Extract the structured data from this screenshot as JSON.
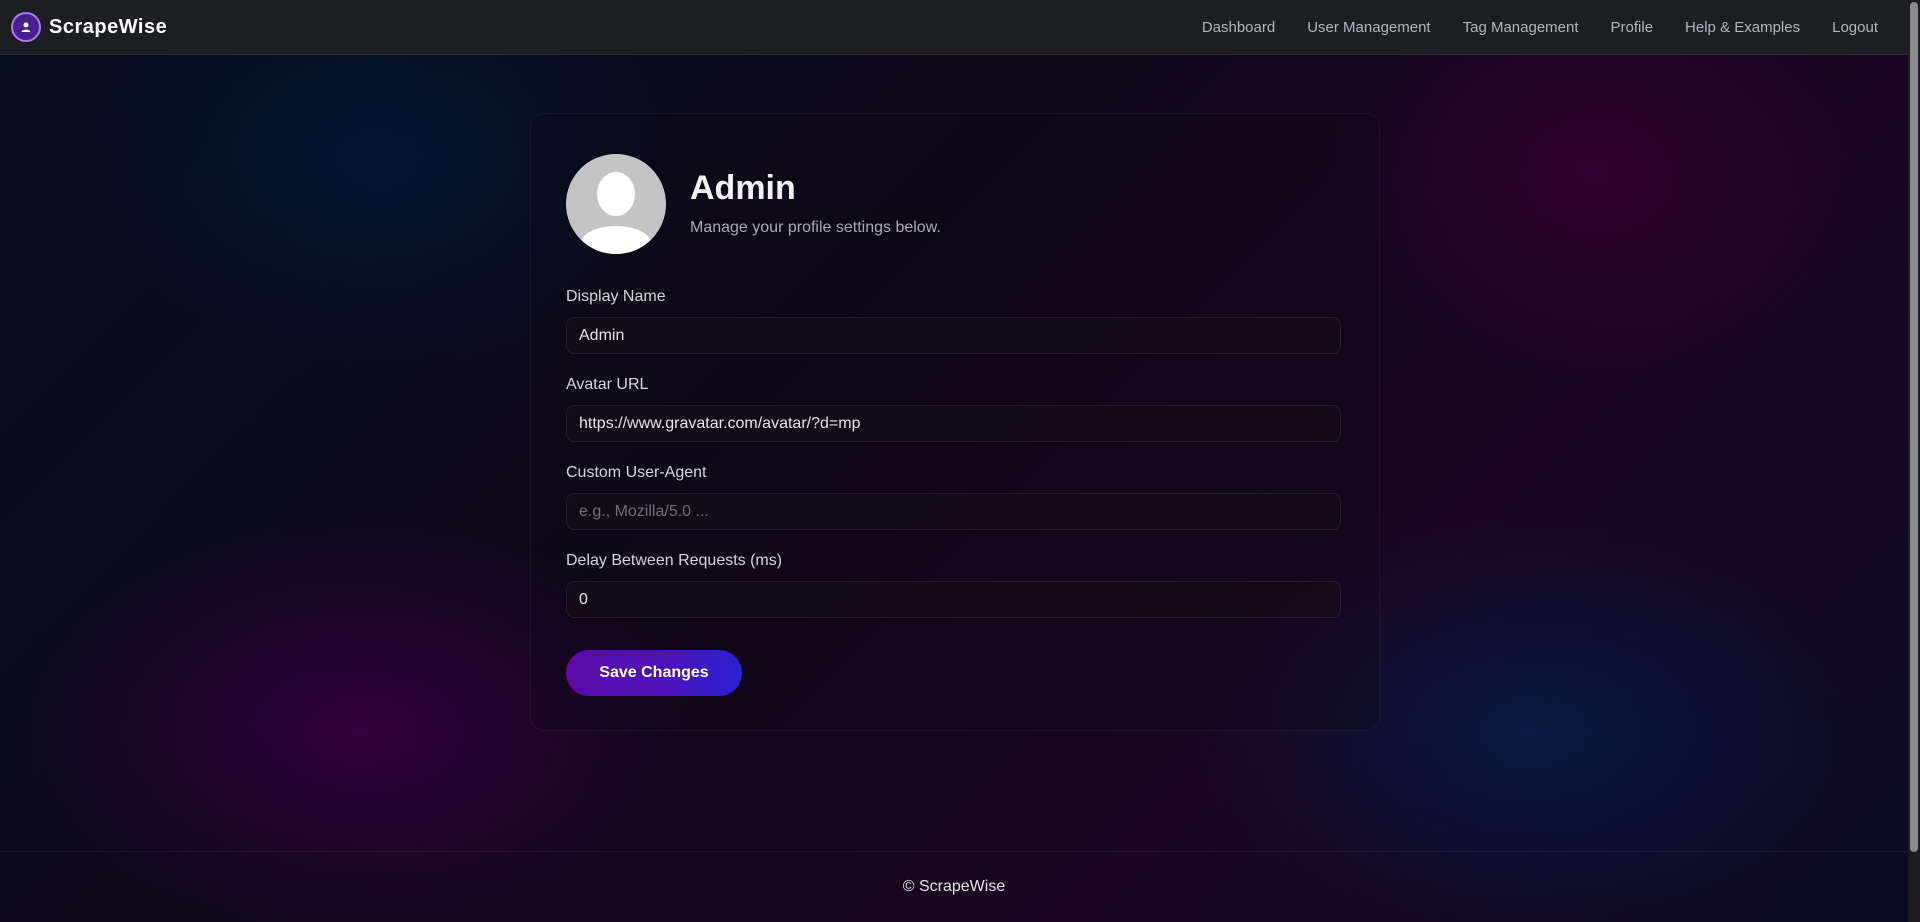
{
  "brand": {
    "name": "ScrapeWise",
    "logo_icon": "user-icon",
    "accent": "#a77ef0"
  },
  "nav": {
    "items": [
      {
        "label": "Dashboard"
      },
      {
        "label": "User Management"
      },
      {
        "label": "Tag Management"
      },
      {
        "label": "Profile"
      },
      {
        "label": "Help & Examples"
      },
      {
        "label": "Logout"
      }
    ]
  },
  "profile": {
    "name": "Admin",
    "subtitle": "Manage your profile settings below.",
    "avatar_icon": "default-avatar-icon"
  },
  "form": {
    "display_name": {
      "label": "Display Name",
      "value": "Admin",
      "placeholder": ""
    },
    "avatar_url": {
      "label": "Avatar URL",
      "value": "https://www.gravatar.com/avatar/?d=mp",
      "placeholder": ""
    },
    "user_agent": {
      "label": "Custom User-Agent",
      "value": "",
      "placeholder": "e.g., Mozilla/5.0 ..."
    },
    "delay": {
      "label": "Delay Between Requests (ms)",
      "value": "0",
      "placeholder": ""
    },
    "save_label": "Save Changes"
  },
  "footer": {
    "text": "© ScrapeWise"
  },
  "colors": {
    "button_start": "#5c0aa8",
    "button_end": "#2a22d4",
    "navbar_bg": "#1c1e22"
  }
}
